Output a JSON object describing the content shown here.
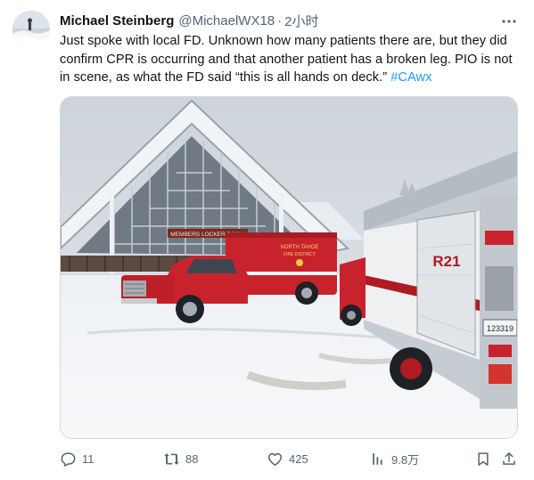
{
  "author": {
    "display_name": "Michael Steinberg",
    "handle": "@MichaelWX18",
    "separator": "·",
    "time": "2小时"
  },
  "tweet": {
    "text": "Just spoke with local FD. Unknown how many patients there are, but they did confirm CPR is occurring and that another patient has a broken leg. PIO is not in scene, as what the FD said “this is all hands on deck.” ",
    "hashtag": "#CAwx"
  },
  "media": {
    "sign_text": "MEMBERS LOCKER ROOM",
    "ambulance_text_1": "NORTH TAHOE",
    "ambulance_text_2": "FIRE DISTRICT",
    "truck_unit": "R21",
    "truck_plate": "123319"
  },
  "actions": {
    "replies": "11",
    "reposts": "88",
    "likes": "425",
    "views": "9.8万"
  },
  "icons": {
    "more": "more-dots-icon",
    "reply": "reply-icon",
    "repost": "retweet-icon",
    "like": "heart-icon",
    "views": "views-chart-icon",
    "bookmark": "bookmark-icon",
    "share": "share-icon"
  },
  "colors": {
    "text": "#0f1419",
    "secondary": "#536471",
    "link": "#1d9bf0"
  }
}
